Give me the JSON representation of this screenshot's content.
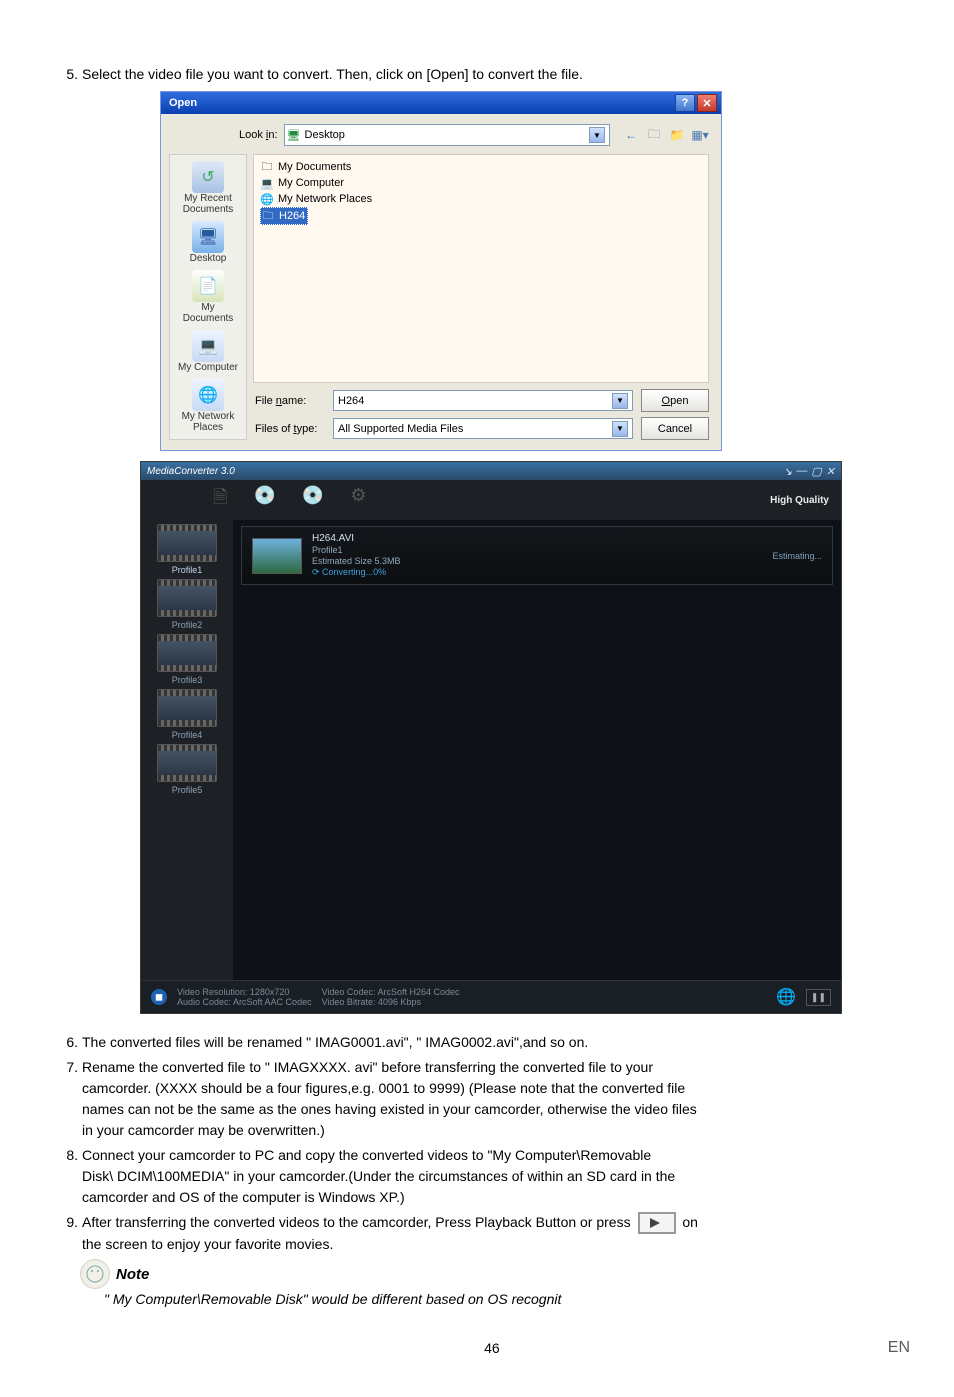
{
  "step5": {
    "num": "5.",
    "text": "Select the video file you want to convert. Then, click on [Open] to convert the file."
  },
  "open_dialog": {
    "title": "Open",
    "look_in_label": "Look in:",
    "look_in_value": "Desktop",
    "sidebar": {
      "recent": "My Recent Documents",
      "desktop": "Desktop",
      "my_docs": "My Documents",
      "my_pc": "My Computer",
      "my_net": "My Network Places"
    },
    "files": {
      "my_docs": "My Documents",
      "my_pc": "My Computer",
      "my_net": "My Network Places",
      "selected": "H264"
    },
    "file_name_label": "File name:",
    "file_name_value": "H264",
    "file_type_label": "Files of type:",
    "file_type_value": "All Supported Media Files",
    "open_btn": "Open",
    "cancel_btn": "Cancel"
  },
  "media_converter": {
    "title": "MediaConverter 3.0",
    "high_quality": "High Quality",
    "profiles": [
      "Profile1",
      "Profile2",
      "Profile3",
      "Profile4",
      "Profile5"
    ],
    "item": {
      "name": "H264.AVI",
      "profile": "Profile1",
      "estimate": "Estimated Size 5.3MB",
      "converting": "Converting...0%",
      "estimating": "Estimating..."
    },
    "status": {
      "video_res": "Video Resolution: 1280x720",
      "audio_codec": "Audio Codec: ArcSoft AAC Codec",
      "video_codec": "Video Codec: ArcSoft H264 Codec",
      "video_bitrate": "Video Bitrate: 4096 Kbps"
    }
  },
  "step6": {
    "num": "6.",
    "text": "The converted files will be renamed \" IMAG0001.avi\", \" IMAG0002.avi\",and so on."
  },
  "step7": {
    "num": "7.",
    "line1": "Rename the converted file to \" IMAGXXXX. avi\" before transferring the converted file to your",
    "line2": "camcorder. (XXXX should be a four figures,e.g. 0001 to 9999) (Please note that the converted file",
    "line3": "names can not be the same as the ones having existed in your camcorder, otherwise the video files",
    "line4": "in your camcorder may be overwritten.)"
  },
  "step8": {
    "num": "8.",
    "line1": "Connect your camcorder to PC and copy the converted videos to \"My Computer\\Removable",
    "line2": "Disk\\ DCIM\\100MEDIA\" in your camcorder.(Under the circumstances of within an SD card in the",
    "line3": "camcorder and OS of the computer is Windows XP.)"
  },
  "step9": {
    "num": "9.",
    "pre": "After transferring the converted videos to the camcorder, Press Playback Button or press",
    "post": "on",
    "line2": "the screen to enjoy your favorite movies."
  },
  "note": {
    "label": "Note",
    "text": "\" My Computer\\Removable Disk\" would be different based on OS recognit"
  },
  "footer": {
    "page": "46",
    "lang": "EN"
  }
}
